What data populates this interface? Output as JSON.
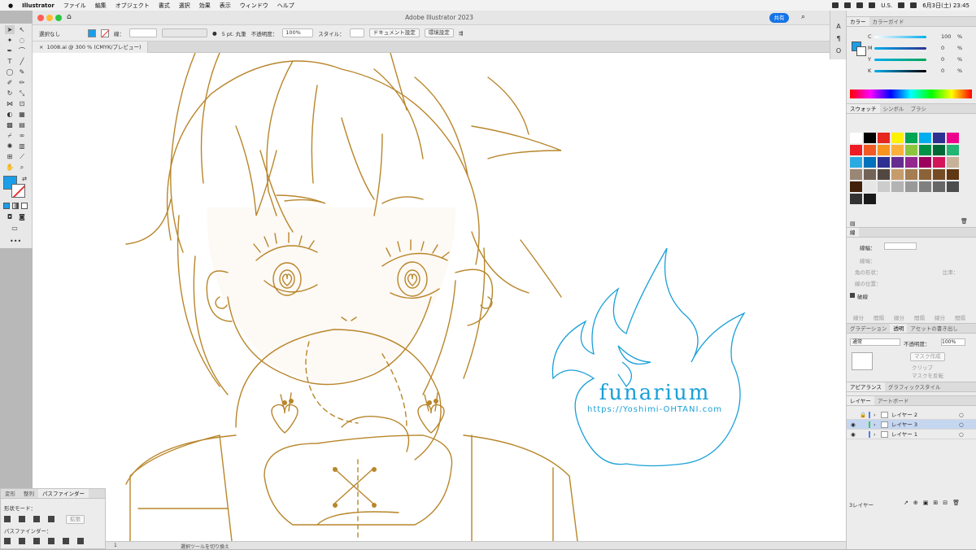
{
  "menubar": {
    "app": "Illustrator",
    "items": [
      "ファイル",
      "編集",
      "オブジェクト",
      "書式",
      "選択",
      "効果",
      "表示",
      "ウィンドウ",
      "ヘルプ"
    ],
    "input_source": "U.S.",
    "clock": "6月3日(土) 23:45"
  },
  "window": {
    "title": "Adobe Illustrator 2023",
    "share": "共有"
  },
  "control": {
    "selection": "選択なし",
    "stroke_label": "線：",
    "brush": "5 pt. 丸筆",
    "opacity_label": "不透明度：",
    "opacity": "100%",
    "style_label": "スタイル：",
    "doc_settings": "ドキュメント設定",
    "prefs": "環境設定",
    "fill_color": "#1a9ee8"
  },
  "doc_tab": {
    "label": "1008.ai @ 300 % (CMYK/プレビュー)"
  },
  "status": {
    "zoom": "1",
    "hint": "選択ツールを切り換え"
  },
  "artwork": {
    "line_color": "#b8862b",
    "logo_color": "#1aa0d8",
    "logo_text": "funarium",
    "logo_url": "https://Yoshimi-OHTANI.com"
  },
  "pathfinder": {
    "tabs": [
      "変形",
      "整列",
      "パスファインダー"
    ],
    "shape_mode": "形状モード：",
    "expand": "拡張",
    "pathfinders": "パスファインダー："
  },
  "color_panel": {
    "tabs": [
      "カラー",
      "カラーガイド"
    ],
    "channels": [
      {
        "label": "C",
        "value": "100",
        "unit": "%"
      },
      {
        "label": "M",
        "value": "0",
        "unit": "%"
      },
      {
        "label": "Y",
        "value": "0",
        "unit": "%"
      },
      {
        "label": "K",
        "value": "0",
        "unit": "%"
      }
    ]
  },
  "swatch_panel": {
    "tabs": [
      "スウォッチ",
      "シンボル",
      "ブラシ"
    ],
    "swatches": [
      "#ffffff",
      "#000000",
      "#e6261f",
      "#fff200",
      "#00a651",
      "#00aeef",
      "#2e3192",
      "#ec008c",
      "#ed1c24",
      "#f15a24",
      "#f7941d",
      "#fbb03b",
      "#8cc63f",
      "#009245",
      "#006837",
      "#22b573",
      "#29abe2",
      "#0071bc",
      "#2e3192",
      "#662d91",
      "#93278f",
      "#9e005d",
      "#d4145a",
      "#c7b299",
      "#998675",
      "#736357",
      "#534741",
      "#c69c6d",
      "#a67c52",
      "#8c6239",
      "#754c24",
      "#603813",
      "#42210b",
      "#e6e6e6",
      "#cccccc",
      "#b3b3b3",
      "#999999",
      "#808080",
      "#666666",
      "#4d4d4d",
      "#333333",
      "#1a1a1a"
    ]
  },
  "stroke_panel": {
    "title": "線",
    "weight_label": "線幅：",
    "cap_label": "線端：",
    "corner_label": "角の形状：",
    "limit_label": "比率：",
    "align_label": "線の位置：",
    "dashed_label": "破線",
    "dash_labels": [
      "線分",
      "間隔",
      "線分",
      "間隔",
      "線分",
      "間隔"
    ]
  },
  "transparency_panel": {
    "tabs": [
      "グラデーション",
      "透明",
      "アセットの書き出し"
    ],
    "blend": "通常",
    "opacity_label": "不透明度：",
    "opacity": "100%",
    "make_mask": "マスク作成",
    "clip": "クリップ",
    "invert": "マスクを反転"
  },
  "appearance_tabs": [
    "アピアランス",
    "グラフィックスタイル"
  ],
  "layers_panel": {
    "tabs": [
      "レイヤー",
      "アートボード"
    ],
    "layers": [
      {
        "name": "レイヤー 2",
        "color": "#4f7ff0",
        "locked": true
      },
      {
        "name": "レイヤー 3",
        "color": "#35c95a",
        "locked": false
      },
      {
        "name": "レイヤー 1",
        "color": "#4f7ff0",
        "locked": false
      }
    ],
    "count": "3レイヤー"
  }
}
